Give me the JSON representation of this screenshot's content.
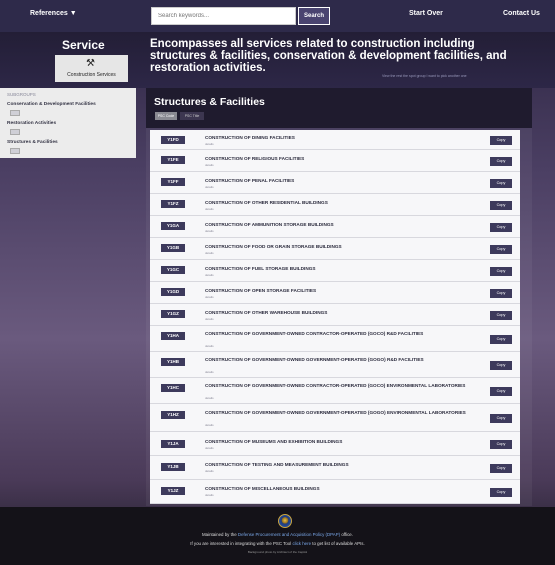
{
  "nav": {
    "references": "References ▼",
    "search_placeholder": "Search keywords...",
    "search_button": "Search",
    "start_over": "Start Over",
    "contact": "Contact Us"
  },
  "header": {
    "service_title": "Service",
    "service_card_label": "Construction Services",
    "headline": "Encompasses all services related to construction including structures & facilities, conservation & development facilities, and restoration activities.",
    "headline_note": "View the rest the spot group I want to pick another one"
  },
  "left_panel": {
    "header": "SUBGROUPS",
    "items": [
      {
        "label": "Conservation & Development Facilities"
      },
      {
        "label": "Restoration Activities"
      },
      {
        "label": "Structures & Facilities"
      }
    ]
  },
  "main": {
    "title": "Structures & Facilities",
    "tabs": [
      "PSC Code",
      "PSC Title"
    ],
    "rows": [
      {
        "code": "Y1FD",
        "title": "CONSTRUCTION OF DINING FACILITIES",
        "sub": "details"
      },
      {
        "code": "Y1FE",
        "title": "CONSTRUCTION OF RELIGIOUS FACILITIES",
        "sub": "details"
      },
      {
        "code": "Y1FF",
        "title": "CONSTRUCTION OF PENAL FACILITIES",
        "sub": "details"
      },
      {
        "code": "Y1FZ",
        "title": "CONSTRUCTION OF OTHER RESIDENTIAL BUILDINGS",
        "sub": "details"
      },
      {
        "code": "Y1GA",
        "title": "CONSTRUCTION OF AMMUNITION STORAGE BUILDINGS",
        "sub": "details"
      },
      {
        "code": "Y1GB",
        "title": "CONSTRUCTION OF FOOD OR GRAIN STORAGE BUILDINGS",
        "sub": "details"
      },
      {
        "code": "Y1GC",
        "title": "CONSTRUCTION OF FUEL STORAGE BUILDINGS",
        "sub": "details"
      },
      {
        "code": "Y1GD",
        "title": "CONSTRUCTION OF OPEN STORAGE FACILITIES",
        "sub": "details"
      },
      {
        "code": "Y1GZ",
        "title": "CONSTRUCTION OF OTHER WAREHOUSE BUILDINGS",
        "sub": "details"
      },
      {
        "code": "Y1HA",
        "title": "CONSTRUCTION OF GOVERNMENT-OWNED CONTRACTOR-OPERATED (GOCO) R&D FACILITIES",
        "sub": "details"
      },
      {
        "code": "Y1HB",
        "title": "CONSTRUCTION OF GOVERNMENT-OWNED GOVERNMENT-OPERATED (GOGO) R&D FACILITIES",
        "sub": "details"
      },
      {
        "code": "Y1HC",
        "title": "CONSTRUCTION OF GOVERNMENT-OWNED CONTRACTOR-OPERATED (GOCO) ENVIRONMENTAL LABORATORIES",
        "sub": "details"
      },
      {
        "code": "Y1HZ",
        "title": "CONSTRUCTION OF GOVERNMENT-OWNED GOVERNMENT-OPERATED (GOGO) ENVIRONMENTAL LABORATORIES",
        "sub": "details"
      },
      {
        "code": "Y1JA",
        "title": "CONSTRUCTION OF MUSEUMS AND EXHIBITION BUILDINGS",
        "sub": "details"
      },
      {
        "code": "Y1JB",
        "title": "CONSTRUCTION OF TESTING AND MEASUREMENT BUILDINGS",
        "sub": "details"
      },
      {
        "code": "Y1JZ",
        "title": "CONSTRUCTION OF MISCELLANEOUS BUILDINGS",
        "sub": "details"
      }
    ],
    "copy_label": "Copy"
  },
  "footer": {
    "line1_prefix": "Maintained by the",
    "line1_link": "Defense Procurement and Acquisition Policy (DPAP)",
    "line1_suffix": "office.",
    "line2_prefix": "If you are interested in integrating with the PSC Tool",
    "line2_link": "click here",
    "line2_suffix": "to get list of available APIs.",
    "line3": "Background photo by Architect of the Capitol"
  }
}
